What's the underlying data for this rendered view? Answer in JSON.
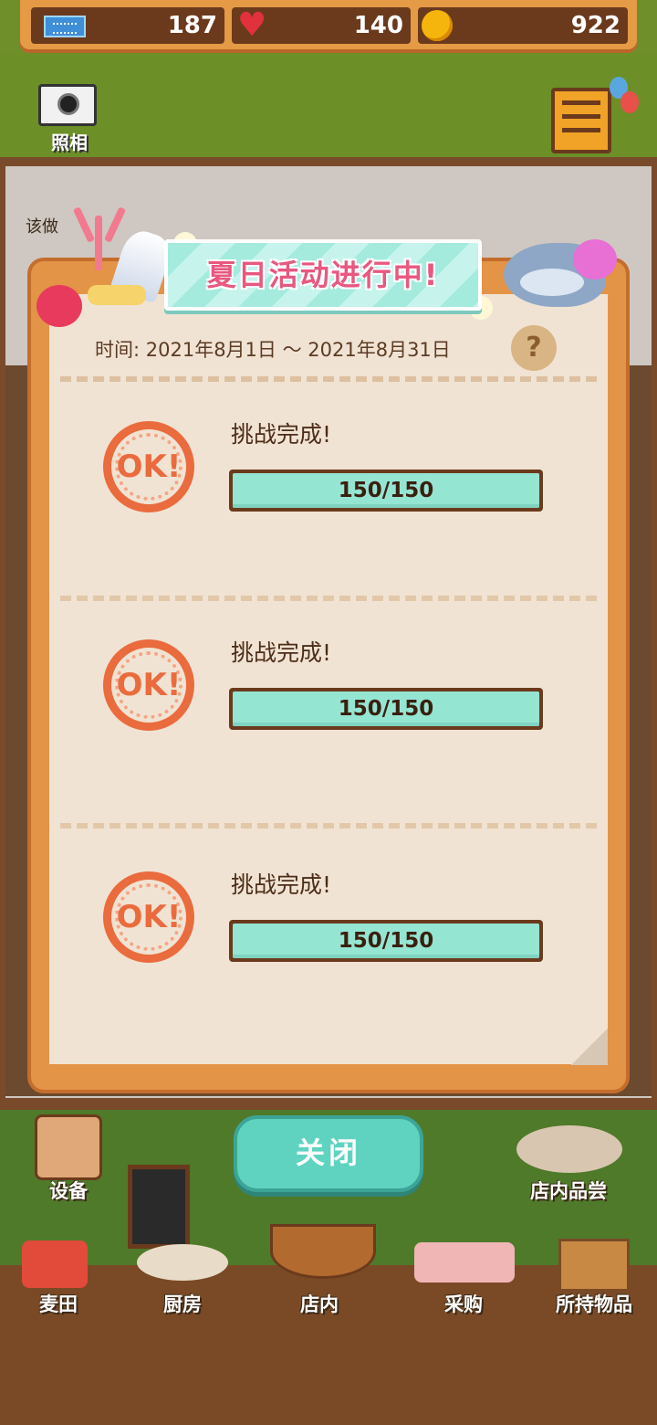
{
  "resources": {
    "tickets": "187",
    "hearts": "140",
    "coins": "922"
  },
  "scene": {
    "camera_label": "照相",
    "blurred_sign": "该做"
  },
  "event": {
    "title": "夏日活动进行中!",
    "date_range": "时间: 2021年8月1日 ～ 2021年8月31日",
    "help_label": "?",
    "challenges": [
      {
        "stamp": "OK!",
        "title": "挑战完成!",
        "progress": "150/150",
        "current": 150,
        "goal": 150
      },
      {
        "stamp": "OK!",
        "title": "挑战完成!",
        "progress": "150/150",
        "current": 150,
        "goal": 150
      },
      {
        "stamp": "OK!",
        "title": "挑战完成!",
        "progress": "150/150",
        "current": 150,
        "goal": 150
      }
    ],
    "close_label": "关闭"
  },
  "bottom": {
    "equipment_label": "设备",
    "tasting_label": "店内品尝",
    "nav": [
      {
        "label": "麦田"
      },
      {
        "label": "厨房"
      },
      {
        "label": "店内"
      },
      {
        "label": "采购"
      },
      {
        "label": "所持物品"
      }
    ]
  },
  "colors": {
    "accent_teal": "#95e5d3",
    "stamp_orange": "#ea6b3d",
    "banner_pink": "#e8587f",
    "panel_orange": "#e39447"
  }
}
